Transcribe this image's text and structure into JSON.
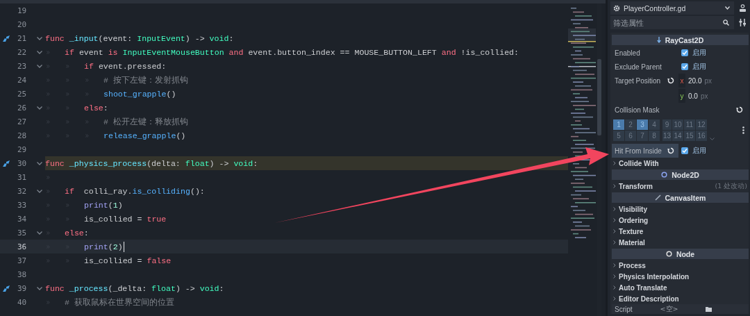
{
  "editor": {
    "lines": [
      {
        "number": "19",
        "fold": false,
        "override": false,
        "highlighted": false,
        "current": false
      },
      {
        "number": "20",
        "fold": false,
        "override": false,
        "highlighted": false,
        "current": false
      },
      {
        "number": "21",
        "fold": true,
        "override": true,
        "highlighted": false,
        "current": false,
        "tokens": [
          {
            "kind": "kw",
            "text": "func"
          },
          {
            "kind": "fn",
            "text": " _input"
          },
          {
            "kind": "plain",
            "text": "(event: "
          },
          {
            "kind": "type",
            "text": "InputEvent"
          },
          {
            "kind": "plain",
            "text": ") -> "
          },
          {
            "kind": "type",
            "text": "void"
          },
          {
            "kind": "plain",
            "text": ":"
          }
        ]
      },
      {
        "number": "22",
        "fold": true,
        "override": false,
        "highlighted": false,
        "current": false,
        "tokens": [
          {
            "kind": "tab"
          },
          {
            "kind": "kw",
            "text": "if"
          },
          {
            "kind": "plain",
            "text": " event "
          },
          {
            "kind": "kw",
            "text": "is"
          },
          {
            "kind": "type",
            "text": " InputEventMouseButton"
          },
          {
            "kind": "kw",
            "text": " and"
          },
          {
            "kind": "plain",
            "text": " event.button_index == MOUSE_BUTTON_LEFT "
          },
          {
            "kind": "kw",
            "text": "and"
          },
          {
            "kind": "plain",
            "text": " !is_collied:"
          }
        ]
      },
      {
        "number": "23",
        "fold": true,
        "override": false,
        "highlighted": false,
        "current": false,
        "tokens": [
          {
            "kind": "tab"
          },
          {
            "kind": "tab"
          },
          {
            "kind": "kw",
            "text": "if"
          },
          {
            "kind": "plain",
            "text": " event.pressed:"
          }
        ]
      },
      {
        "number": "24",
        "fold": false,
        "override": false,
        "highlighted": false,
        "current": false,
        "tokens": [
          {
            "kind": "tab"
          },
          {
            "kind": "tab"
          },
          {
            "kind": "tab"
          },
          {
            "kind": "comment",
            "text": "# 按下左键：发射抓钩"
          }
        ]
      },
      {
        "number": "25",
        "fold": false,
        "override": false,
        "highlighted": false,
        "current": false,
        "tokens": [
          {
            "kind": "tab"
          },
          {
            "kind": "tab"
          },
          {
            "kind": "tab"
          },
          {
            "kind": "call",
            "text": "shoot_grapple"
          },
          {
            "kind": "plain",
            "text": "()"
          }
        ]
      },
      {
        "number": "26",
        "fold": true,
        "override": false,
        "highlighted": false,
        "current": false,
        "tokens": [
          {
            "kind": "tab"
          },
          {
            "kind": "tab"
          },
          {
            "kind": "kw",
            "text": "else"
          },
          {
            "kind": "plain",
            "text": ":"
          }
        ]
      },
      {
        "number": "27",
        "fold": false,
        "override": false,
        "highlighted": false,
        "current": false,
        "tokens": [
          {
            "kind": "tab"
          },
          {
            "kind": "tab"
          },
          {
            "kind": "tab"
          },
          {
            "kind": "comment",
            "text": "# 松开左键：释放抓钩"
          }
        ]
      },
      {
        "number": "28",
        "fold": false,
        "override": false,
        "highlighted": false,
        "current": false,
        "tokens": [
          {
            "kind": "tab"
          },
          {
            "kind": "tab"
          },
          {
            "kind": "tab"
          },
          {
            "kind": "call",
            "text": "release_grapple"
          },
          {
            "kind": "plain",
            "text": "()"
          }
        ]
      },
      {
        "number": "29",
        "fold": false,
        "override": false,
        "highlighted": false,
        "current": false
      },
      {
        "number": "30",
        "fold": true,
        "override": true,
        "highlighted": true,
        "current": false,
        "tokens": [
          {
            "kind": "kw",
            "text": "func"
          },
          {
            "kind": "fn",
            "text": " _physics_process"
          },
          {
            "kind": "plain",
            "text": "(delta: "
          },
          {
            "kind": "type",
            "text": "float"
          },
          {
            "kind": "plain",
            "text": ") -> "
          },
          {
            "kind": "type",
            "text": "void"
          },
          {
            "kind": "plain",
            "text": ":"
          }
        ]
      },
      {
        "number": "31",
        "fold": false,
        "override": false,
        "highlighted": false,
        "current": false,
        "tokens": [
          {
            "kind": "tab"
          }
        ]
      },
      {
        "number": "32",
        "fold": true,
        "override": false,
        "highlighted": false,
        "current": false,
        "tokens": [
          {
            "kind": "tab"
          },
          {
            "kind": "kw",
            "text": "if"
          },
          {
            "kind": "plain",
            "text": "  colli_ray."
          },
          {
            "kind": "call",
            "text": "is_colliding"
          },
          {
            "kind": "plain",
            "text": "():"
          }
        ]
      },
      {
        "number": "33",
        "fold": false,
        "override": false,
        "highlighted": false,
        "current": false,
        "tokens": [
          {
            "kind": "tab"
          },
          {
            "kind": "tab"
          },
          {
            "kind": "builtin",
            "text": "print"
          },
          {
            "kind": "plain",
            "text": "("
          },
          {
            "kind": "num",
            "text": "1"
          },
          {
            "kind": "plain",
            "text": ")"
          }
        ]
      },
      {
        "number": "34",
        "fold": false,
        "override": false,
        "highlighted": false,
        "current": false,
        "tokens": [
          {
            "kind": "tab"
          },
          {
            "kind": "tab"
          },
          {
            "kind": "plain",
            "text": "is_collied = "
          },
          {
            "kind": "kw",
            "text": "true"
          }
        ]
      },
      {
        "number": "35",
        "fold": true,
        "override": false,
        "highlighted": false,
        "current": false,
        "tokens": [
          {
            "kind": "tab"
          },
          {
            "kind": "kw",
            "text": "else"
          },
          {
            "kind": "plain",
            "text": ":"
          }
        ]
      },
      {
        "number": "36",
        "fold": false,
        "override": false,
        "highlighted": false,
        "current": true,
        "tokens": [
          {
            "kind": "tab"
          },
          {
            "kind": "tab"
          },
          {
            "kind": "builtin",
            "text": "print"
          },
          {
            "kind": "plain",
            "text": "("
          },
          {
            "kind": "num",
            "text": "2"
          },
          {
            "kind": "plain",
            "text": ")"
          },
          {
            "kind": "cursor"
          }
        ]
      },
      {
        "number": "37",
        "fold": false,
        "override": false,
        "highlighted": false,
        "current": false,
        "tokens": [
          {
            "kind": "tab"
          },
          {
            "kind": "tab"
          },
          {
            "kind": "plain",
            "text": "is_collied = "
          },
          {
            "kind": "kw",
            "text": "false"
          }
        ]
      },
      {
        "number": "38",
        "fold": false,
        "override": false,
        "highlighted": false,
        "current": false
      },
      {
        "number": "39",
        "fold": true,
        "override": true,
        "highlighted": false,
        "current": false,
        "tokens": [
          {
            "kind": "kw",
            "text": "func"
          },
          {
            "kind": "fn",
            "text": " _process"
          },
          {
            "kind": "plain",
            "text": "(_delta: "
          },
          {
            "kind": "type",
            "text": "float"
          },
          {
            "kind": "plain",
            "text": ") -> "
          },
          {
            "kind": "type",
            "text": "void"
          },
          {
            "kind": "plain",
            "text": ":"
          }
        ]
      },
      {
        "number": "40",
        "fold": false,
        "override": false,
        "highlighted": false,
        "current": false,
        "tokens": [
          {
            "kind": "tab"
          },
          {
            "kind": "comment",
            "text": "# 获取鼠标在世界空间的位置"
          }
        ]
      }
    ]
  },
  "inspector": {
    "file": "PlayerController.gd",
    "filter_placeholder": "筛选属性",
    "rows": [
      {
        "kind": "header",
        "label": "RayCast2D"
      },
      {
        "kind": "check",
        "label": "Enabled",
        "checked": true,
        "value": "启用",
        "revertable": false,
        "highlighted": false
      },
      {
        "kind": "check",
        "label": "Exclude Parent",
        "checked": true,
        "value": "启用",
        "revertable": false,
        "highlighted": false
      },
      {
        "kind": "vector",
        "label": "Target Position",
        "revertable": true,
        "components": [
          {
            "axis": "x",
            "value": "20.0",
            "unit": "px"
          },
          {
            "axis": "y",
            "value": "0.0",
            "unit": "px"
          }
        ]
      },
      {
        "kind": "label",
        "label": "Collision Mask",
        "revertable": true
      },
      {
        "kind": "mask",
        "layers": [
          {
            "label": "1",
            "selected": true
          },
          {
            "label": "2",
            "selected": false
          },
          {
            "label": "3",
            "selected": true
          },
          {
            "label": "4",
            "selected": false
          },
          {
            "label": "9",
            "selected": false
          },
          {
            "label": "10",
            "selected": false
          },
          {
            "label": "11",
            "selected": false
          },
          {
            "label": "12",
            "selected": false
          },
          {
            "label": "5",
            "selected": false
          },
          {
            "label": "6",
            "selected": false
          },
          {
            "label": "7",
            "selected": false
          },
          {
            "label": "8",
            "selected": false
          },
          {
            "label": "13",
            "selected": false
          },
          {
            "label": "14",
            "selected": false
          },
          {
            "label": "15",
            "selected": false
          },
          {
            "label": "16",
            "selected": false
          }
        ]
      },
      {
        "kind": "check",
        "label": "Hit From Inside",
        "checked": true,
        "value": "启用",
        "revertable": true,
        "highlighted": true
      },
      {
        "kind": "group",
        "label": "Collide With",
        "expanded": false
      },
      {
        "kind": "header",
        "label": "Node2D"
      },
      {
        "kind": "group",
        "label": "Transform",
        "expanded": false,
        "note": "(1 处改动)"
      },
      {
        "kind": "header",
        "label": "CanvasItem"
      },
      {
        "kind": "group",
        "label": "Visibility",
        "expanded": false
      },
      {
        "kind": "group",
        "label": "Ordering",
        "expanded": false
      },
      {
        "kind": "group",
        "label": "Texture",
        "expanded": false
      },
      {
        "kind": "group",
        "label": "Material",
        "expanded": false
      },
      {
        "kind": "header",
        "label": "Node"
      },
      {
        "kind": "group",
        "label": "Process",
        "expanded": false
      },
      {
        "kind": "group",
        "label": "Physics Interpolation",
        "expanded": false
      },
      {
        "kind": "group",
        "label": "Auto Translate",
        "expanded": false
      },
      {
        "kind": "group",
        "label": "Editor Description",
        "expanded": false
      },
      {
        "kind": "script",
        "label": "Script",
        "value": "<空>"
      }
    ]
  }
}
